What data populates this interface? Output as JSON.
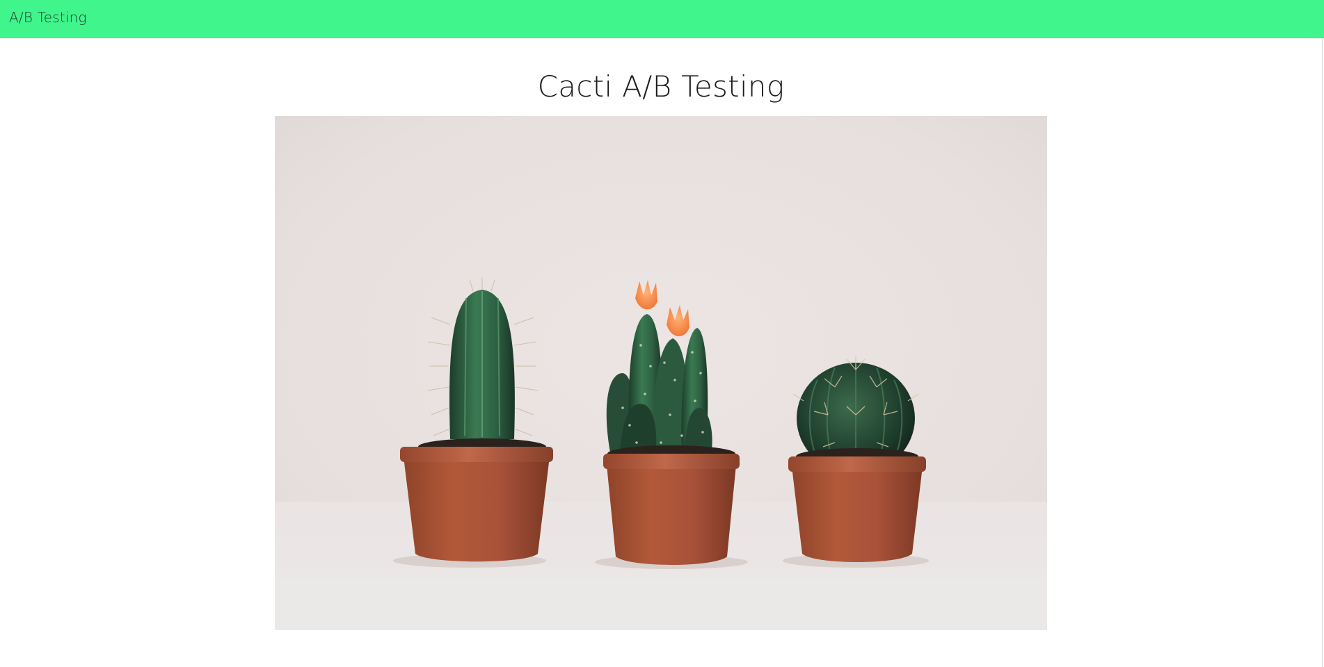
{
  "navbar": {
    "brand": "A/B Testing",
    "color": "#41f58d"
  },
  "main": {
    "title": "Cacti A/B Testing",
    "image": {
      "subject": "three-potted-cacti-photo"
    }
  }
}
